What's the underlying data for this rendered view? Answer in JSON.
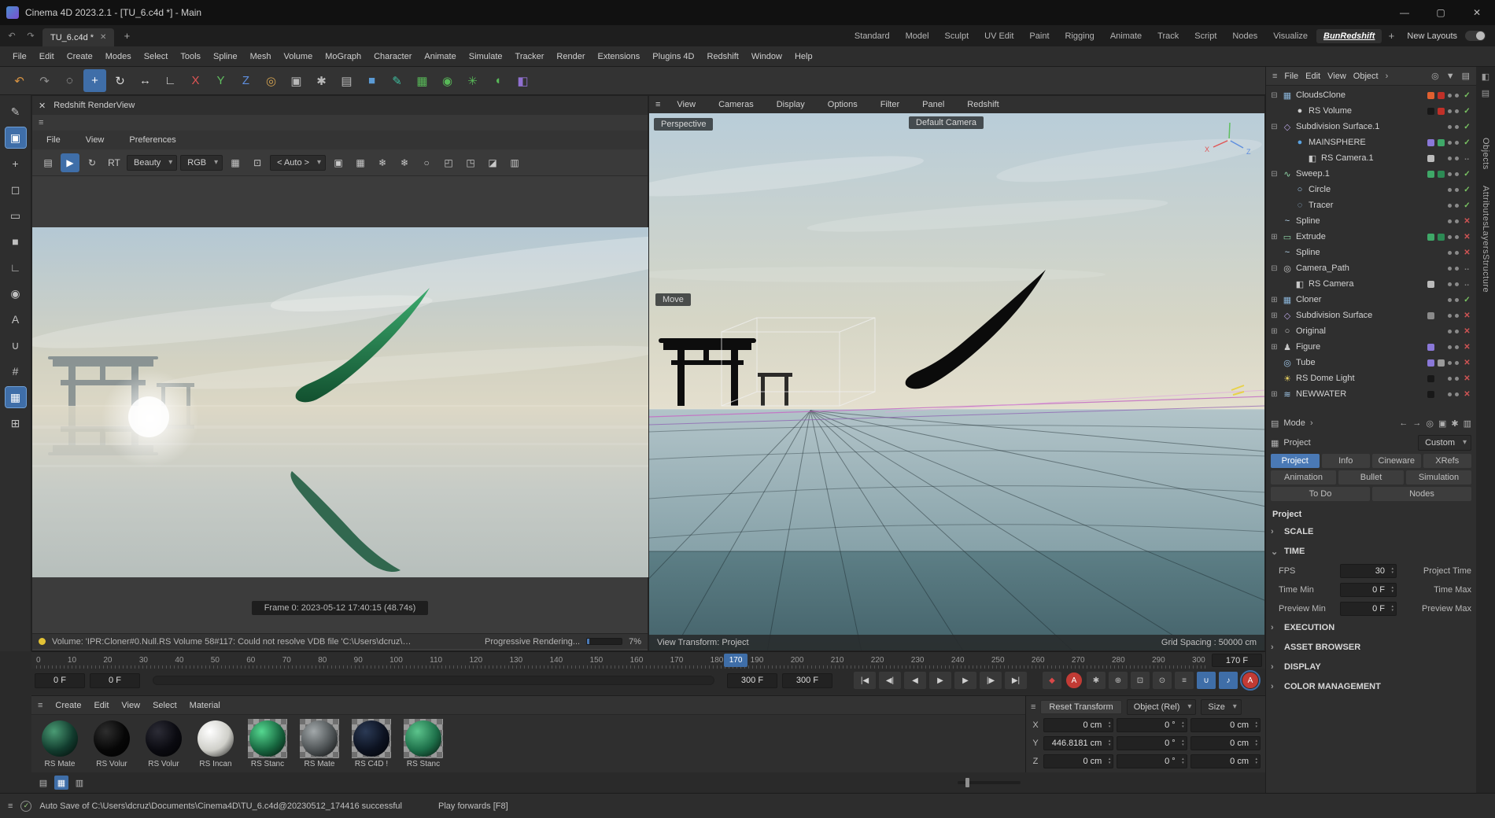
{
  "colors": {
    "accent": "#3f6ea8",
    "check_green": "#7ac462",
    "error_red": "#d05454"
  },
  "titlebar": {
    "title": "Cinema 4D 2023.2.1 - [TU_6.c4d *] - Main",
    "minimize": "—",
    "maximize": "▢",
    "close": "✕"
  },
  "tabrow": {
    "back": "↶",
    "forward": "↷",
    "doc_tab": "TU_6.c4d *",
    "close": "✕",
    "add": "+",
    "add_layout": "+",
    "new_layouts": "New Layouts",
    "layouts": [
      {
        "label": "Standard"
      },
      {
        "label": "Model"
      },
      {
        "label": "Sculpt"
      },
      {
        "label": "UV Edit"
      },
      {
        "label": "Paint"
      },
      {
        "label": "Rigging"
      },
      {
        "label": "Animate"
      },
      {
        "label": "Track"
      },
      {
        "label": "Script"
      },
      {
        "label": "Nodes"
      },
      {
        "label": "Visualize"
      },
      {
        "label": "BunRedshift",
        "active": true
      }
    ]
  },
  "menubar": {
    "items": [
      "File",
      "Edit",
      "Create",
      "Modes",
      "Select",
      "Tools",
      "Spline",
      "Mesh",
      "Volume",
      "MoGraph",
      "Character",
      "Animate",
      "Simulate",
      "Tracker",
      "Render",
      "Extensions",
      "Plugins 4D",
      "Redshift",
      "Window",
      "Help"
    ]
  },
  "toolbar": {
    "icons": [
      {
        "name": "undo-icon",
        "glyph": "↶",
        "color": "#d79342"
      },
      {
        "name": "redo-icon",
        "glyph": "↷",
        "color": "#8f8f8f"
      },
      {
        "name": "live-selection-icon",
        "glyph": "◌",
        "color": "#d8d8d8"
      },
      {
        "name": "move-tool-icon",
        "glyph": "+",
        "color": "#ffffff",
        "active": true
      },
      {
        "name": "rotate-tool-icon",
        "glyph": "↻",
        "color": "#d8d8d8"
      },
      {
        "name": "scale-tool-icon",
        "glyph": "↔",
        "color": "#d8d8d8"
      },
      {
        "name": "axis-lock-icon",
        "glyph": "∟",
        "color": "#d8d8d8"
      },
      {
        "name": "x-axis-button",
        "glyph": "X",
        "color": "#e05555"
      },
      {
        "name": "y-axis-button",
        "glyph": "Y",
        "color": "#5fbf5f"
      },
      {
        "name": "z-axis-button",
        "glyph": "Z",
        "color": "#5f8fdf"
      },
      {
        "name": "coordinate-system-icon",
        "glyph": "◎",
        "color": "#d0a050"
      },
      {
        "name": "render-view-button",
        "glyph": "▣",
        "color": "#b8b8b8"
      },
      {
        "name": "render-settings-button",
        "glyph": "✱",
        "color": "#b8b8b8"
      },
      {
        "name": "render-queue-button",
        "glyph": "▤",
        "color": "#b8b8b8"
      },
      {
        "name": "primitive-cube-button",
        "glyph": "■",
        "color": "#5b9bd5"
      },
      {
        "name": "spline-pen-button",
        "glyph": "✎",
        "color": "#3fbfa0"
      },
      {
        "name": "mograph-button",
        "glyph": "▦",
        "color": "#58b858"
      },
      {
        "name": "volume-button",
        "glyph": "◉",
        "color": "#58b858"
      },
      {
        "name": "simulation-button",
        "glyph": "✳",
        "color": "#58b858"
      },
      {
        "name": "field-button",
        "glyph": "◖",
        "color": "#58b858"
      },
      {
        "name": "character-button",
        "glyph": "◧",
        "color": "#9070d0"
      }
    ]
  },
  "left_toolbar": {
    "icons": [
      {
        "name": "pen-tool-icon",
        "glyph": "✎"
      },
      {
        "name": "model-mode-icon",
        "glyph": "▣",
        "active": true
      },
      {
        "name": "move-palette-icon",
        "glyph": "+"
      },
      {
        "name": "selection-icon",
        "glyph": "◻"
      },
      {
        "name": "rect-select-icon",
        "glyph": "▭"
      },
      {
        "name": "cube-icon",
        "glyph": "■"
      },
      {
        "name": "corner-icon",
        "glyph": "∟"
      },
      {
        "name": "sphere-icon",
        "glyph": "◉"
      },
      {
        "name": "capsule-icon",
        "glyph": "A"
      },
      {
        "name": "loop-icon",
        "glyph": "∪"
      },
      {
        "name": "grid-icon",
        "glyph": "#"
      },
      {
        "name": "snap-grid-icon",
        "glyph": "▦",
        "active": true
      },
      {
        "name": "workplane-icon",
        "glyph": "⊞"
      }
    ]
  },
  "renderview": {
    "close": "✕",
    "window_title": "Redshift RenderView",
    "menu_icon": "≡",
    "menus": [
      "File",
      "View",
      "Preferences"
    ],
    "icons_left": [
      {
        "name": "snapshot-save-icon",
        "glyph": "▤"
      },
      {
        "name": "ipr-play-button",
        "glyph": "▶",
        "active": true
      },
      {
        "name": "restart-render-icon",
        "glyph": "↻"
      },
      {
        "name": "rt-toggle",
        "glyph": "RT"
      }
    ],
    "beauty_dropdown": "Beauty",
    "rgb_label": "RGB",
    "icons_mid": [
      {
        "name": "checker-icon",
        "glyph": "▦"
      },
      {
        "name": "crop-icon",
        "glyph": "⊡"
      }
    ],
    "auto_dropdown": "< Auto >",
    "icons_right": [
      {
        "name": "lock-icon",
        "glyph": "▣"
      },
      {
        "name": "grid-icon",
        "glyph": "▦"
      },
      {
        "name": "snapshot-a-icon",
        "glyph": "❄"
      },
      {
        "name": "snapshot-b-icon",
        "glyph": "❄"
      },
      {
        "name": "ab-compare-icon",
        "glyph": "○"
      },
      {
        "name": "fit-screen-icon",
        "glyph": "◰"
      },
      {
        "name": "zoom-fit-icon",
        "glyph": "◳"
      },
      {
        "name": "gradient-icon",
        "glyph": "◪"
      },
      {
        "name": "image-icon",
        "glyph": "▥"
      }
    ],
    "frame_info": "Frame  0:  2023-05-12  17:40:15  (48.74s)",
    "warning_text": "Volume: 'IPR:Cloner#0.Null.RS Volume 58#117: Could not resolve VDB file 'C:\\Users\\dcruz\\D...",
    "progress_label": "Progressive Rendering...",
    "progress_percent": "7%"
  },
  "viewport": {
    "menu_icon": "≡",
    "menus": [
      "View",
      "Cameras",
      "Display",
      "Options",
      "Filter",
      "Panel",
      "Redshift"
    ],
    "view_label": "Perspective",
    "camera_label": "Default Camera",
    "move_label": "Move",
    "axis_x": "X",
    "axis_z": "Z",
    "footer_left": "View Transform: Project",
    "footer_right": "Grid Spacing : 50000 cm"
  },
  "object_manager": {
    "menu_icon": "≡",
    "menus": [
      "File",
      "Edit",
      "View",
      "Object"
    ],
    "overflow": "›",
    "header_icons": [
      {
        "name": "search-icon",
        "glyph": "◎"
      },
      {
        "name": "filter-icon",
        "glyph": "▼"
      },
      {
        "name": "browser-icon",
        "glyph": "▤"
      }
    ],
    "objects": [
      {
        "name": "CloudsClone",
        "expander": "⊟",
        "icon": "cloner-icon",
        "glyph": "▦",
        "icon_color": "#8ab4d8",
        "indent": 0,
        "state": "check",
        "chip1": "#e06030",
        "chip2": "#c03028"
      },
      {
        "name": "RS Volume",
        "expander": "",
        "icon": "volume-icon",
        "glyph": "●",
        "icon_color": "#d0d0d0",
        "indent": 1,
        "state": "check",
        "chip1": "#181818",
        "chip2": "#c03028"
      },
      {
        "name": "Subdivision Surface.1",
        "expander": "⊟",
        "icon": "subdivision-icon",
        "glyph": "◇",
        "icon_color": "#b9a6e3",
        "indent": 0,
        "state": "check"
      },
      {
        "name": "MAINSPHERE",
        "expander": "",
        "icon": "sphere-icon",
        "glyph": "●",
        "icon_color": "#5aa2e0",
        "indent": 1,
        "state": "check",
        "chip1": "#8a78d8",
        "chip2": "#3fa868"
      },
      {
        "name": "RS Camera.1",
        "expander": "",
        "icon": "camera-icon",
        "glyph": "◧",
        "icon_color": "#c8c8c8",
        "indent": 2,
        "state": "dots",
        "chip1": "#bbbbbb"
      },
      {
        "name": "Sweep.1",
        "expander": "⊟",
        "icon": "sweep-icon",
        "glyph": "∿",
        "icon_color": "#8fd6a8",
        "indent": 0,
        "state": "check",
        "chip1": "#3fa868",
        "chip2": "#2c8a54"
      },
      {
        "name": "Circle",
        "expander": "",
        "icon": "circle-spline-icon",
        "glyph": "○",
        "icon_color": "#9fc6e8",
        "indent": 1,
        "state": "check"
      },
      {
        "name": "Tracer",
        "expander": "",
        "icon": "tracer-icon",
        "glyph": "◌",
        "icon_color": "#9fc6e8",
        "indent": 1,
        "state": "check"
      },
      {
        "name": "Spline",
        "expander": "",
        "icon": "spline-icon",
        "glyph": "~",
        "icon_color": "#b8d8f0",
        "indent": 0,
        "state": "x"
      },
      {
        "name": "Extrude",
        "expander": "⊞",
        "icon": "extrude-icon",
        "glyph": "▭",
        "icon_color": "#8fd6a8",
        "indent": 0,
        "state": "x",
        "chip1": "#3fa868",
        "chip2": "#2c8a54"
      },
      {
        "name": "Spline",
        "expander": "",
        "icon": "spline-icon",
        "glyph": "~",
        "icon_color": "#b8d8f0",
        "indent": 0,
        "state": "x"
      },
      {
        "name": "Camera_Path",
        "expander": "⊟",
        "icon": "camera-path-icon",
        "glyph": "◎",
        "icon_color": "#c8c8c8",
        "indent": 0,
        "state": "dots"
      },
      {
        "name": "RS Camera",
        "expander": "",
        "icon": "camera-icon",
        "glyph": "◧",
        "icon_color": "#c8c8c8",
        "indent": 1,
        "state": "dots",
        "chip1": "#bbbbbb"
      },
      {
        "name": "Cloner",
        "expander": "⊞",
        "icon": "cloner-icon",
        "glyph": "▦",
        "icon_color": "#8ab4d8",
        "indent": 0,
        "state": "check"
      },
      {
        "name": "Subdivision Surface",
        "expander": "⊞",
        "icon": "subdivision-icon",
        "glyph": "◇",
        "icon_color": "#b9a6e3",
        "indent": 0,
        "state": "x",
        "chip1": "#8a8a8a"
      },
      {
        "name": "Original",
        "expander": "⊞",
        "icon": "null-icon",
        "glyph": "○",
        "icon_color": "#c8c8c8",
        "indent": 0,
        "state": "x"
      },
      {
        "name": "Figure",
        "expander": "⊞",
        "icon": "figure-icon",
        "glyph": "♟",
        "icon_color": "#c8c8c8",
        "indent": 0,
        "state": "x",
        "chip1": "#8a78d8"
      },
      {
        "name": "Tube",
        "expander": "",
        "icon": "tube-icon",
        "glyph": "◎",
        "icon_color": "#9fc6e8",
        "indent": 0,
        "state": "x",
        "chip1": "#8a78d8",
        "chip2": "#9a9a9a"
      },
      {
        "name": "RS Dome Light",
        "expander": "",
        "icon": "dome-light-icon",
        "glyph": "☀",
        "icon_color": "#e8d060",
        "indent": 0,
        "state": "x",
        "chip1": "#181818"
      },
      {
        "name": "NEWWATER",
        "expander": "⊞",
        "icon": "water-icon",
        "glyph": "≋",
        "icon_color": "#9fc6e8",
        "indent": 0,
        "state": "x",
        "chip1": "#181818"
      }
    ]
  },
  "attributes": {
    "mode_icon": "▤",
    "mode_label": "Mode",
    "mode_caret": "›",
    "nav_icons": [
      {
        "name": "back-icon",
        "glyph": "←"
      },
      {
        "name": "forward-icon",
        "glyph": "→"
      },
      {
        "name": "search-icon",
        "glyph": "◎"
      },
      {
        "name": "lock-icon",
        "glyph": "▣"
      },
      {
        "name": "gear-icon",
        "glyph": "✱"
      },
      {
        "name": "panel-icon",
        "glyph": "▥"
      }
    ],
    "object_icon": "▦",
    "object_label": "Project",
    "custom_dropdown": "Custom",
    "tabs_row1": [
      {
        "label": "Project",
        "active": true
      },
      {
        "label": "Info"
      },
      {
        "label": "Cineware"
      },
      {
        "label": "XRefs"
      }
    ],
    "tabs_row2": [
      {
        "label": "Animation"
      },
      {
        "label": "Bullet"
      },
      {
        "label": "Simulation"
      }
    ],
    "tabs_row3": [
      {
        "label": "To Do"
      },
      {
        "label": "Nodes"
      }
    ],
    "title": "Project",
    "sections_top": [
      {
        "label": "SCALE",
        "caret": "›"
      },
      {
        "label": "TIME",
        "caret": "⌄"
      }
    ],
    "time_rows": [
      {
        "label": "FPS",
        "value": "30",
        "label2": "Project Time"
      },
      {
        "label": "Time Min",
        "value": "0 F",
        "label2": "Time Max"
      },
      {
        "label": "Preview Min",
        "value": "0 F",
        "label2": "Preview Max"
      }
    ],
    "sections_bottom": [
      {
        "label": "EXECUTION",
        "caret": "›"
      },
      {
        "label": "ASSET BROWSER",
        "caret": "›"
      },
      {
        "label": "DISPLAY",
        "caret": "›"
      },
      {
        "label": "COLOR MANAGEMENT",
        "caret": "›"
      }
    ]
  },
  "right_dock": {
    "top_icons": [
      {
        "name": "layout-icon",
        "glyph": "◧"
      },
      {
        "name": "list-icon",
        "glyph": "▤"
      }
    ],
    "tabs": [
      "Objects",
      "Attributes",
      "Layers",
      "Structure"
    ]
  },
  "timeline": {
    "ticks": [
      "0",
      "10",
      "20",
      "30",
      "40",
      "50",
      "60",
      "70",
      "80",
      "90",
      "100",
      "110",
      "120",
      "130",
      "140",
      "150",
      "160",
      "170",
      "180",
      "190",
      "200",
      "210",
      "220",
      "230",
      "240",
      "250",
      "260",
      "270",
      "280",
      "290",
      "300"
    ],
    "playhead": "170",
    "current_frame": "170 F",
    "range_fields": [
      "0 F",
      "0 F"
    ],
    "end_fields": [
      "300 F",
      "300 F"
    ],
    "transport": [
      {
        "name": "go-to-start-button",
        "glyph": "|◀"
      },
      {
        "name": "previous-key-button",
        "glyph": "◀|"
      },
      {
        "name": "previous-frame-button",
        "glyph": "◀"
      },
      {
        "name": "play-button",
        "glyph": "▶"
      },
      {
        "name": "next-frame-button",
        "glyph": "▶"
      },
      {
        "name": "next-key-button",
        "glyph": "|▶"
      },
      {
        "name": "go-to-end-button",
        "glyph": "▶|"
      }
    ],
    "record": [
      {
        "name": "record-keyframe-button",
        "glyph": "◆",
        "color": "#d84848"
      },
      {
        "name": "autokey-button",
        "glyph": "A",
        "round": "red"
      },
      {
        "name": "keyframe-settings-button",
        "glyph": "✱",
        "color": "#c0c0c0"
      },
      {
        "name": "record-position-button",
        "glyph": "⊕",
        "color": "#c0c0c0"
      },
      {
        "name": "record-scale-button",
        "glyph": "⊡",
        "color": "#c0c0c0"
      },
      {
        "name": "record-rotation-button",
        "glyph": "⊙",
        "color": "#c0c0c0"
      },
      {
        "name": "record-parameter-button",
        "glyph": "≡",
        "color": "#c0c0c0"
      },
      {
        "name": "record-pla-button",
        "glyph": "∪",
        "color": "#ffffff",
        "active": true
      },
      {
        "name": "sound-button",
        "glyph": "♪",
        "color": "#ffffff",
        "active": true
      },
      {
        "name": "solo-button",
        "glyph": "A",
        "round": "red",
        "active": true
      }
    ]
  },
  "materials": {
    "menu_icon": "≡",
    "menus": [
      "Create",
      "Edit",
      "View",
      "Select",
      "Material"
    ],
    "items": [
      {
        "name": "RS Mate",
        "color": "#123c2e",
        "hi": "#4a9b74"
      },
      {
        "name": "RS Volur",
        "color": "#060606",
        "hi": "#2e2e2e"
      },
      {
        "name": "RS Volur",
        "color": "#0a0a10",
        "hi": "#2c2c36"
      },
      {
        "name": "RS Incan",
        "color": "#cfcfc9",
        "hi": "#ffffff"
      },
      {
        "name": "RS Stanc",
        "color": "#17663f",
        "hi": "#55d890",
        "checker": true
      },
      {
        "name": "RS Mate",
        "color": "#4d5254",
        "hi": "#a2a8aa",
        "checker": true
      },
      {
        "name": "RS C4D !",
        "color": "#0c1220",
        "hi": "#2b3a55",
        "checker": true
      },
      {
        "name": "RS Stanc",
        "color": "#1d6f49",
        "hi": "#5cc48c",
        "checker": true
      }
    ]
  },
  "coordinates": {
    "menu_icon": "≡",
    "reset_button": "Reset Transform",
    "object_dropdown": "Object (Rel)",
    "size_dropdown": "Size",
    "rows": [
      {
        "axis": "X",
        "pos": "0 cm",
        "rot": "0 °",
        "scl": "0 cm"
      },
      {
        "axis": "Y",
        "pos": "446.8181 cm",
        "rot": "0 °",
        "scl": "0 cm"
      },
      {
        "axis": "Z",
        "pos": "0 cm",
        "rot": "0 °",
        "scl": "0 cm"
      }
    ]
  },
  "bottom_bar": {
    "icons": [
      {
        "name": "list-view-icon",
        "glyph": "▤"
      },
      {
        "name": "icon-view-icon",
        "glyph": "▦",
        "active": true
      },
      {
        "name": "detail-view-icon",
        "glyph": "▥"
      }
    ]
  },
  "statusbar": {
    "menu_icon": "≡",
    "status_icon": "✓",
    "autosave_text": "Auto Save of C:\\Users\\dcruz\\Documents\\Cinema4D\\TU_6.c4d@20230512_174416 successful",
    "hint_text": "Play forwards [F8]"
  }
}
